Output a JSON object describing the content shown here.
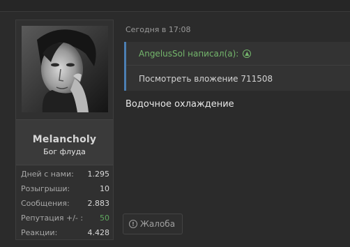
{
  "user": {
    "name": "Melancholy",
    "title": "Бог флуда",
    "stats": [
      {
        "label": "Дней с нами:",
        "value": "1.295"
      },
      {
        "label": "Розыгрыши:",
        "value": "10"
      },
      {
        "label": "Сообщения:",
        "value": "2.883"
      },
      {
        "label": "Репутация +/- :",
        "value": "50"
      },
      {
        "label": "Реакции:",
        "value": "4.428"
      }
    ]
  },
  "post": {
    "date": "Сегодня в 17:08",
    "quote": {
      "author": "AngelusSol написал(а):",
      "body": "Посмотреть вложение 711508"
    },
    "text": "Водочное охлаждение",
    "report_label": "Жалоба"
  },
  "colors": {
    "accent": "#4c7fb3",
    "quote_author": "#74b66c",
    "reputation": "#5fa85f"
  }
}
